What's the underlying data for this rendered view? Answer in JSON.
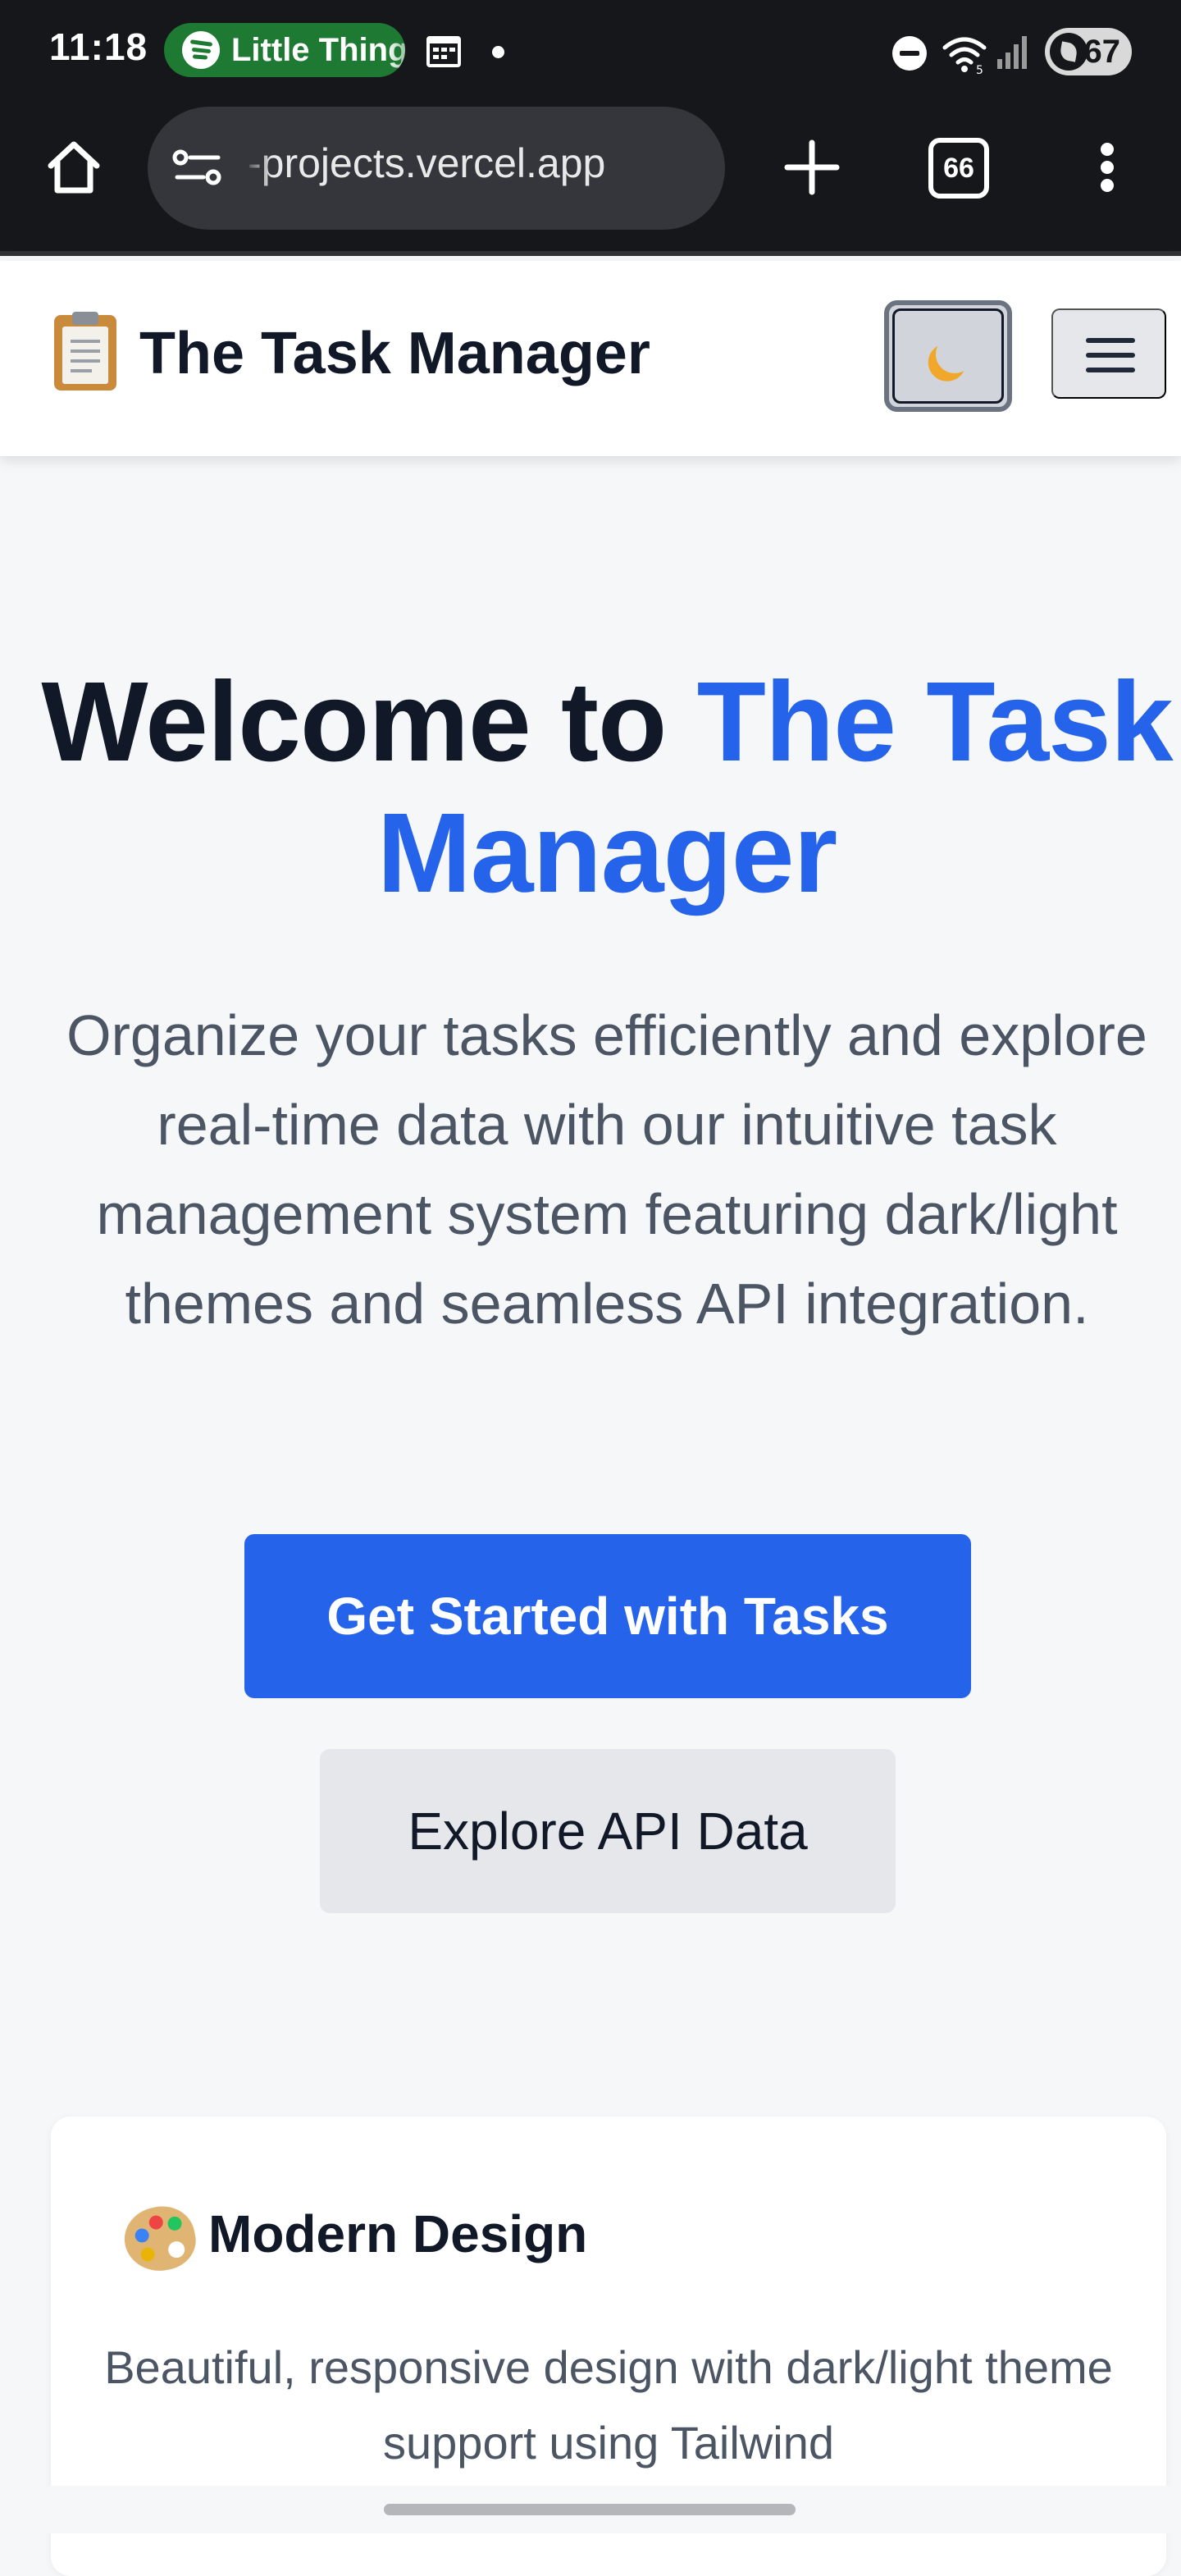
{
  "status_bar": {
    "time": "11:18",
    "now_playing": "Little Things",
    "battery": "67",
    "icons": [
      "spotify-icon",
      "calendar-icon",
      "dnd-icon",
      "wifi-icon",
      "signal-icon",
      "battery-icon"
    ]
  },
  "browser": {
    "url": "-projects.vercel.app",
    "tab_count": "66",
    "icons": [
      "home-icon",
      "site-settings-icon",
      "plus-icon",
      "tab-switcher-icon",
      "more-vert-icon"
    ]
  },
  "app_header": {
    "emoji": "📋",
    "title": "The Task Manager",
    "theme_toggle_icon": "moon-icon",
    "menu_icon": "hamburger-icon"
  },
  "hero": {
    "title_prefix": "Welcome to ",
    "title_brand_part1": "The Task",
    "title_brand_part2": "Manager",
    "description": "Organize your tasks efficiently and explore real-time data with our intuitive task management system featuring dark/light themes and seamless API integration.",
    "primary_cta": "Get Started with Tasks",
    "secondary_cta": "Explore API Data"
  },
  "features": [
    {
      "icon": "palette-icon",
      "title": "Modern Design",
      "description": "Beautiful, responsive design with dark/light theme support using Tailwind"
    }
  ],
  "colors": {
    "brand_blue": "#2563eb",
    "heading_text": "#111827",
    "body_text": "#4b5563",
    "page_background": "#f6f7f9",
    "browser_chrome": "#16171a",
    "secondary_button": "#e5e7eb"
  }
}
